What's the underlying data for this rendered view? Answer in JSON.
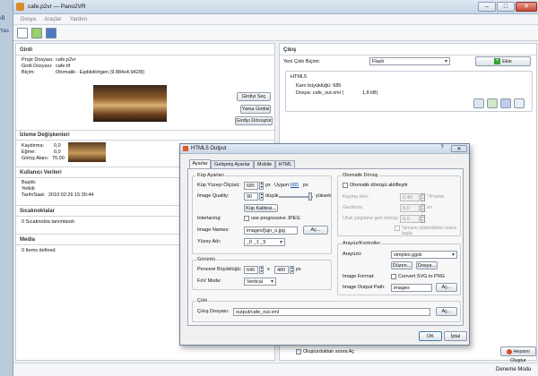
{
  "bg_strip": {
    "top": "ıB",
    "mid": "Yas"
  },
  "window": {
    "title": "cafe.p2vr — Pano2VR",
    "controls": [
      "–",
      "□",
      "✕"
    ]
  },
  "menu": [
    "Dosya",
    "Araçlar",
    "Yardım"
  ],
  "girdi": {
    "title": "Girdi",
    "proje_label": "Proje Dosyası:",
    "proje_value": "cafe.p2vr",
    "girdi_label": "Girdi Dosyası:",
    "girdi_value": "cafe.tif",
    "bicim_label": "Biçim:",
    "bicim_value": "Otomatik - Eşdikdörtgen (9.884x4.942/8)",
    "btn_sec": "Girdiyi Seç",
    "btn_yama": "Yama Girdisi",
    "btn_donustur": "Girdiyi Dönüştür"
  },
  "izleme": {
    "title": "İzleme Değişkenleri",
    "kaydirma_label": "Kaydırma:",
    "kaydirma_value": "0,0",
    "egme_label": "Eğme:",
    "egme_value": "0,0",
    "gorus_label": "Görüş Alanı:",
    "gorus_value": "70,00"
  },
  "kullanici": {
    "title": "Kullanıcı Verileri",
    "baslik": "Başlık:",
    "yetkili": "Yetkili:",
    "tarih": "Tarih/Saat:",
    "tarih_value": "2010:02:26 15:30:44"
  },
  "sicak": {
    "title": "Sıcaknoktalar",
    "value": "0 Sıcaknokta tanımlandı"
  },
  "medya": {
    "title": "Media",
    "value": "0 Items defined"
  },
  "cikis": {
    "title": "Çıkış",
    "yeni_label": "Yeni Çıktı Biçimi:",
    "yeni_value": "Flash",
    "ekle": "Ekle",
    "html5_title": "HTML5",
    "karo": "Karo büyüklüğü: 685",
    "dosya": "Dosya: cafe_out.xml (",
    "dosya_size": "1,8 kB)",
    "oto_label": "Oluşturduktan sonra Aç",
    "hepsini": "Hepsini Oluştur"
  },
  "status": "Deneme Modu",
  "dialog": {
    "title": "HTML5 Output",
    "tabs": [
      "Ayarlar",
      "Gelişmiş Ayarlar",
      "Mobile",
      "HTML"
    ],
    "kup_group": "Küp Ayarları",
    "kup_olcusu_label": "Küp Yüzeyi Ölçüsü:",
    "kup_olcusu_value": "685",
    "kup_px": "px",
    "kup_uygun": "Uygun:",
    "kup_uygun_value": "685",
    "kup_px2": "px",
    "quality_label": "Image Quality:",
    "quality_value": "90",
    "dusuk": "düşük",
    "yuksek": "yüksek",
    "kup_kalitesi": "Küp Kalitesi...",
    "interlacing_label": "Interlacing:",
    "interlacing_check": "use progressive JPEG",
    "image_names_label": "Image Names:",
    "image_names_value": "images/[ajn_o.jpg",
    "image_names_btn": "Aç...",
    "yuzey_label": "Yüzey Adı:",
    "yuzey_value": "_0 _1 _5",
    "gorunum_group": "Görüntü",
    "pencere_label": "Pencere Büyüklüğü:",
    "pencere_w": "640",
    "pencere_x": "x",
    "pencere_h": "480",
    "pencere_px": "px",
    "fov_label": "FoV Mode:",
    "fov_value": "Vertical",
    "oto_group": "Otomatik Dönüş",
    "oto_check": "Otomatik dönüşü aktifleştir",
    "kayma_label": "Kayma Hızı:",
    "kayma_value": "0,40",
    "kayma_unit": "°/Frame",
    "gecikme_label": "Gecikme:",
    "gecikme_value": "5,0",
    "gecikme_unit": "sn",
    "ufuk_label": "Ufuk çizgisine geri dönüş:",
    "ufuk_value": "0,0",
    "tamami": "Tamamı yüklendikten sonra başla",
    "arayuz_group": "Arayüz/Kontroller",
    "arayuz_label": "Arayüzü:",
    "arayuz_value": "simplex.ggsk",
    "duzen_btn": "Düzen...",
    "dosya_btn": "Dosya...",
    "img_format_label": "Image Format:",
    "img_format_check": "Convert SVG to PNG",
    "img_out_label": "Image Output Path:",
    "img_out_value": "images",
    "img_out_btn": "Aç...",
    "cikti_group": "Çıktı",
    "cikis_dosya_label": "Çıkış Dosyası:",
    "cikis_dosya_value": "output/cafe_out.xml",
    "cikis_btn": "Aç...",
    "ok": "OK",
    "iptal": "İptal"
  }
}
